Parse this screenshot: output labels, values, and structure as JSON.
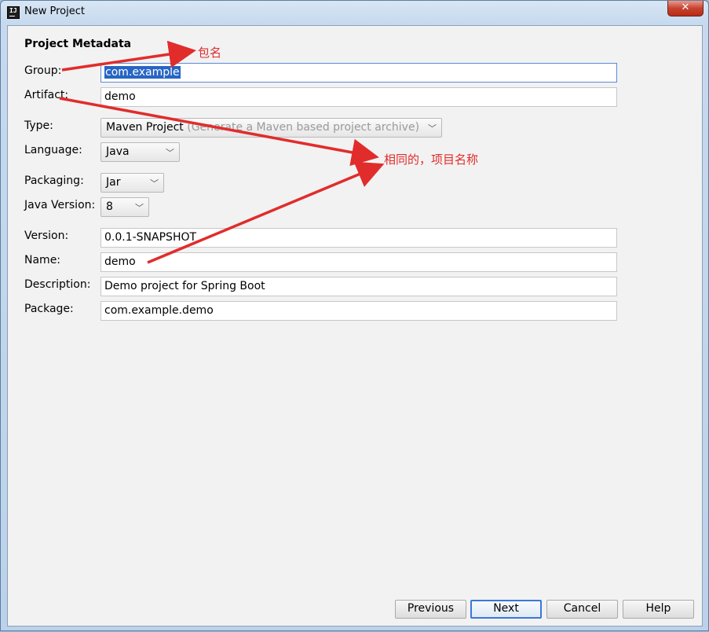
{
  "window": {
    "title": "New Project",
    "app_icon_text": "IJ",
    "close_symbol": "✕"
  },
  "form": {
    "section_title": "Project Metadata",
    "group": {
      "label": "Group:",
      "value": "com.example"
    },
    "artifact": {
      "label": "Artifact:",
      "value": "demo"
    },
    "type": {
      "label": "Type:",
      "value": "Maven Project",
      "hint": "(Generate a Maven based project archive)"
    },
    "language": {
      "label": "Language:",
      "value": "Java"
    },
    "packaging": {
      "label": "Packaging:",
      "value": "Jar"
    },
    "java_version": {
      "label": "Java Version:",
      "value": "8"
    },
    "version": {
      "label": "Version:",
      "value": "0.0.1-SNAPSHOT"
    },
    "name": {
      "label": "Name:",
      "value": "demo"
    },
    "description": {
      "label": "Description:",
      "value": "Demo project for Spring Boot"
    },
    "package": {
      "label": "Package:",
      "value": "com.example.demo"
    }
  },
  "buttons": {
    "previous": "Previous",
    "next": "Next",
    "cancel": "Cancel",
    "help": "Help"
  },
  "annotations": {
    "group_note": "包名",
    "artifact_name_note": "相同的，项目名称",
    "color": "#e12c2c"
  }
}
